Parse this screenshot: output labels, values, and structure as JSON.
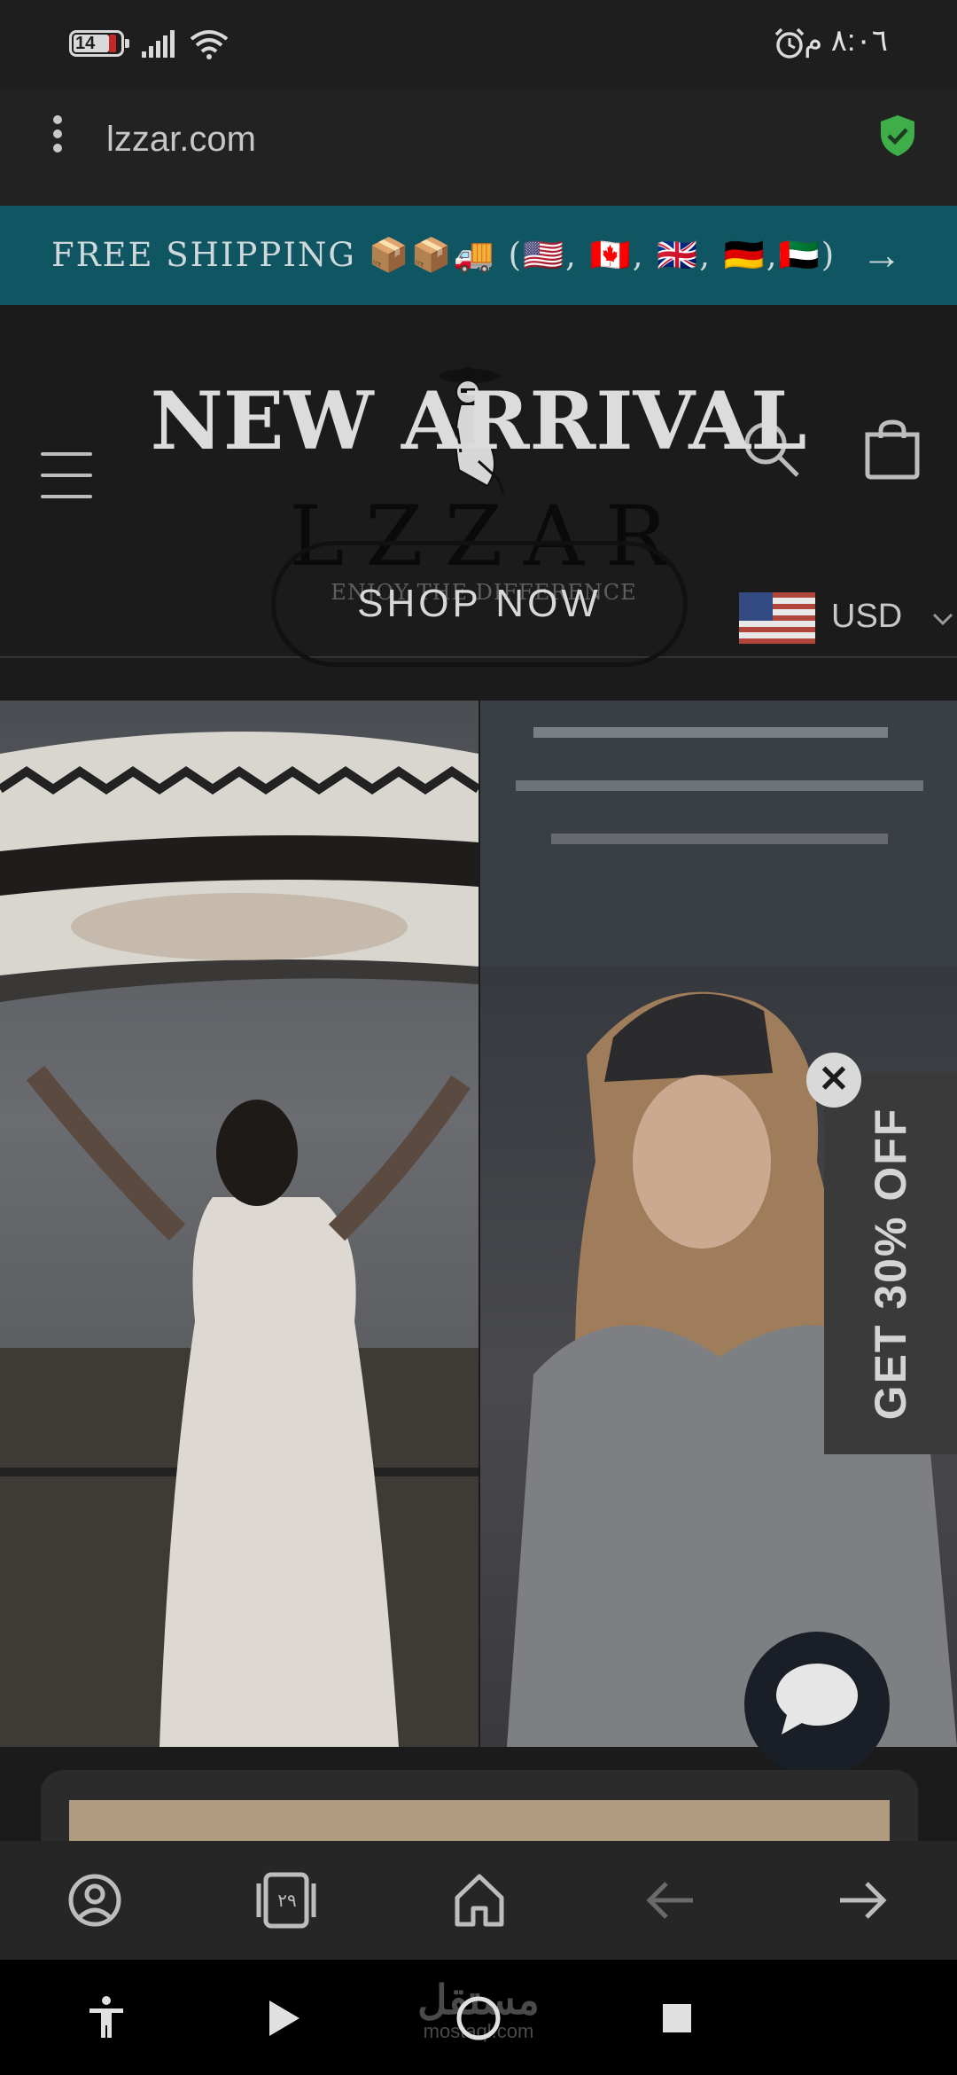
{
  "status_bar": {
    "battery": "14",
    "time": "٨:٠٦ م"
  },
  "browser": {
    "url": "lzzar.com"
  },
  "banner": {
    "text": "FREE SHIPPING 📦📦🚚 (🇺🇸, 🇨🇦, 🇬🇧, 🇩🇪,🇦🇪)",
    "arrow": "→"
  },
  "header": {
    "logo_word": "LZZAR",
    "tagline": "ENJOY THE DIFFERENCE",
    "currency": "USD"
  },
  "hero": {
    "title": "NEW ARRIVAL",
    "cta": "SHOP NOW"
  },
  "discount": {
    "label": "GET 30% OFF",
    "close": "✕"
  },
  "browser_nav": {
    "tab_count": "٢٩"
  },
  "watermark": {
    "main": "مستقل",
    "sub": "mostaql.com"
  },
  "colors": {
    "banner": "#0f5662",
    "shield": "#3fae49",
    "background": "#1b1b1b"
  }
}
